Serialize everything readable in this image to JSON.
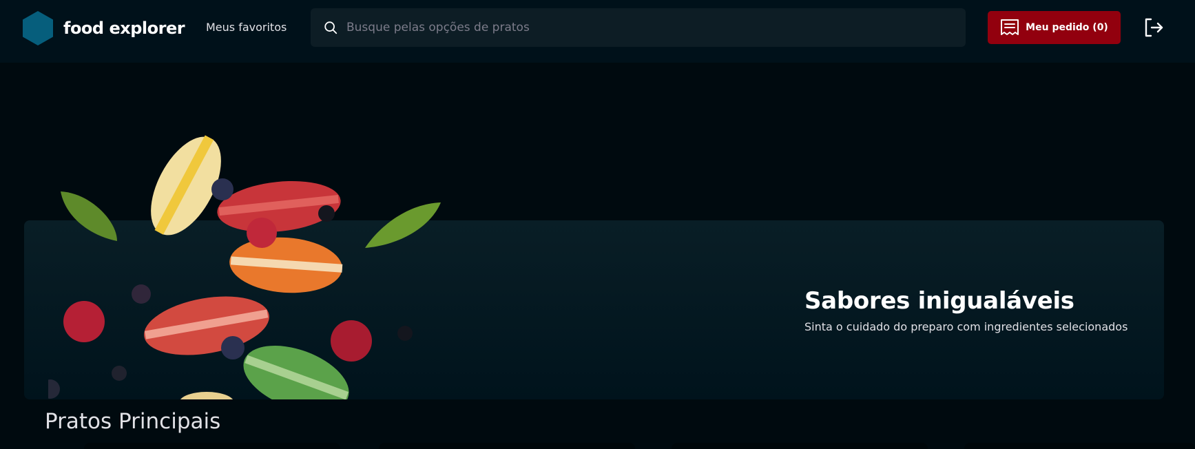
{
  "header": {
    "logo_text": "food explorer",
    "logo_icon": "hexagon-logo-icon",
    "favorites_label": "Meus favoritos",
    "search": {
      "placeholder": "Busque pelas opções de pratos",
      "value": "",
      "icon": "search-icon"
    },
    "order_button": {
      "label": "Meu pedido (0)",
      "icon": "receipt-icon"
    },
    "logout_icon": "sign-out-icon"
  },
  "banner": {
    "title": "Sabores inigualáveis",
    "subtitle": "Sinta o cuidado do preparo com ingredientes selecionados",
    "image": "macarons-illustration"
  },
  "section": {
    "title": "Pratos Principais"
  },
  "colors": {
    "header_bg": "#00111a",
    "page_bg": "#000a0f",
    "accent": "#92000e",
    "logo": "#065e7c",
    "banner_bg": "#091e26"
  }
}
